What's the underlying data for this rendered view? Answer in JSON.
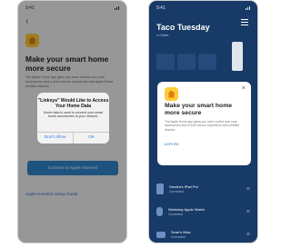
{
  "left_screen": {
    "status_time": "9:41",
    "title": "Make your smart home more secure",
    "body": "The Apple Home app gives you more control over your accessories and a more secure experience with Apple Home certified devices.",
    "alert": {
      "title": "\"Linksys\" Would Like to Access Your Home Data",
      "message": "Home data is used to connect your smart home accessories to your network.",
      "deny_label": "Don't Allow",
      "allow_label": "OK"
    },
    "primary_button": "Connect to Apple HomeKit",
    "link": "Apple HomeKit Setup Guide"
  },
  "right_screen": {
    "status_time": "9:41",
    "network_name": "Taco Tuesday",
    "network_status": "● Online",
    "card": {
      "title": "Make your smart home more secure",
      "body": "The Apple Home app gives you more control over your accessories and a more secure experience with certified devices.",
      "link": "Let's Go"
    },
    "devices": [
      {
        "name": "Sandra's iPad Pro",
        "status": "Connected"
      },
      {
        "name": "Weekday Apple Watch",
        "status": "Connected"
      },
      {
        "name": "Sean's iMac",
        "status": "Connected"
      }
    ]
  },
  "colors": {
    "accent": "#2f86cc",
    "navy": "#173a66",
    "home_yellow": "#ffcc33"
  }
}
